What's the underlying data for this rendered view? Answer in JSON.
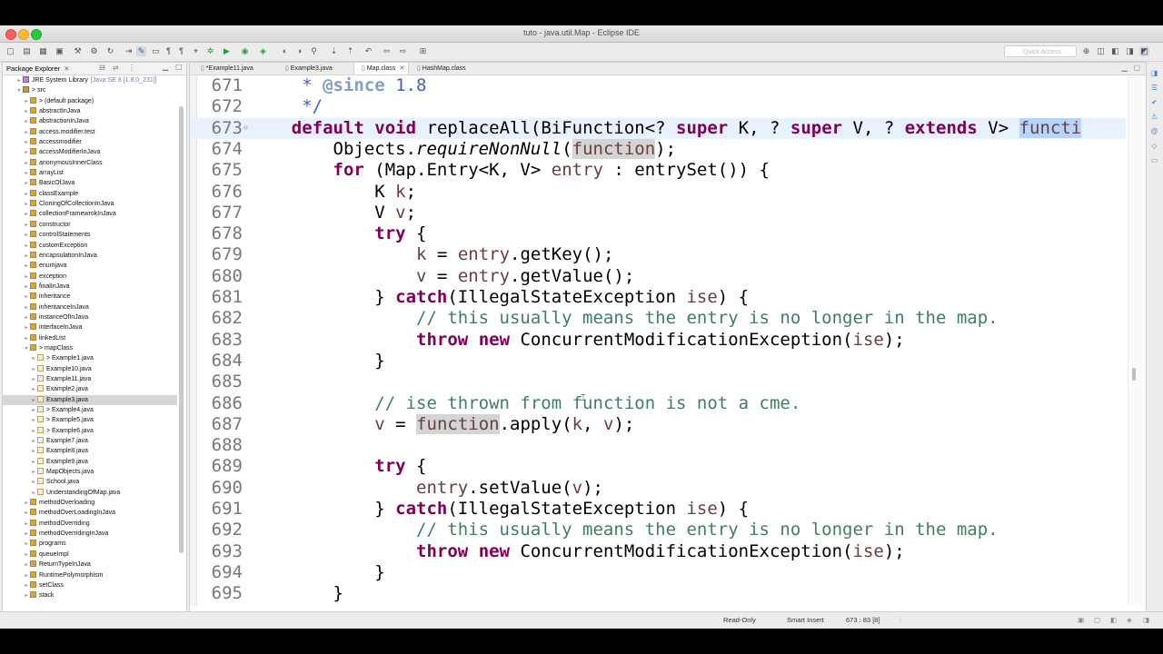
{
  "window": {
    "title": "tuto - java.util.Map - Eclipse IDE"
  },
  "toolbar": {
    "quick_access": "Quick Access"
  },
  "package_explorer": {
    "tab_label": "Package Explorer",
    "items": [
      {
        "label": "JRE System Library",
        "suffix": "[Java SE 8 [1.8.0_231]]",
        "icon": "library-icon",
        "indent": 2,
        "arrow": "▸"
      },
      {
        "label": "> src",
        "icon": "source-folder-icon",
        "indent": 2,
        "arrow": "▾"
      },
      {
        "label": "> (default package)",
        "icon": "package-icon",
        "indent": 3,
        "arrow": "▸"
      },
      {
        "label": "abstractInJava",
        "icon": "package-icon",
        "indent": 3,
        "arrow": "▸"
      },
      {
        "label": "abstractionInJava",
        "icon": "package-icon",
        "indent": 3,
        "arrow": "▸"
      },
      {
        "label": "access.modifier.test",
        "icon": "package-icon",
        "indent": 3,
        "arrow": "▸"
      },
      {
        "label": "accessmodifier",
        "icon": "package-icon",
        "indent": 3,
        "arrow": "▸"
      },
      {
        "label": "accessModifierInJava",
        "icon": "package-icon",
        "indent": 3,
        "arrow": "▸"
      },
      {
        "label": "anonymousInnerClass",
        "icon": "package-icon",
        "indent": 3,
        "arrow": "▸"
      },
      {
        "label": "arrayList",
        "icon": "package-icon",
        "indent": 3,
        "arrow": "▸"
      },
      {
        "label": "BasicOfJava",
        "icon": "package-icon",
        "indent": 3,
        "arrow": "▸"
      },
      {
        "label": "classExample",
        "icon": "package-icon",
        "indent": 3,
        "arrow": "▸"
      },
      {
        "label": "CloningOfCollectionInJava",
        "icon": "package-icon",
        "indent": 3,
        "arrow": "▸"
      },
      {
        "label": "collectionFramewrokInJava",
        "icon": "package-icon",
        "indent": 3,
        "arrow": "▸"
      },
      {
        "label": "constructor",
        "icon": "package-icon",
        "indent": 3,
        "arrow": "▸"
      },
      {
        "label": "controlStatements",
        "icon": "package-icon",
        "indent": 3,
        "arrow": "▸"
      },
      {
        "label": "customException",
        "icon": "package-icon",
        "indent": 3,
        "arrow": "▸"
      },
      {
        "label": "encapsulationInJava",
        "icon": "package-icon",
        "indent": 3,
        "arrow": "▸"
      },
      {
        "label": "enumjava",
        "icon": "package-icon",
        "indent": 3,
        "arrow": "▸"
      },
      {
        "label": "exception",
        "icon": "package-icon",
        "indent": 3,
        "arrow": "▸"
      },
      {
        "label": "finalInJava",
        "icon": "package-icon",
        "indent": 3,
        "arrow": "▸"
      },
      {
        "label": "inheritance",
        "icon": "package-icon",
        "indent": 3,
        "arrow": "▸"
      },
      {
        "label": "inheritanceInJava",
        "icon": "package-icon",
        "indent": 3,
        "arrow": "▸"
      },
      {
        "label": "instanceOfInJava",
        "icon": "package-icon",
        "indent": 3,
        "arrow": "▸"
      },
      {
        "label": "interfaceInJava",
        "icon": "package-icon",
        "indent": 3,
        "arrow": "▸"
      },
      {
        "label": "linkedList",
        "icon": "package-icon",
        "indent": 3,
        "arrow": "▸"
      },
      {
        "label": "> mapClass",
        "icon": "package-icon",
        "indent": 3,
        "arrow": "▾"
      },
      {
        "label": "> Example1.java",
        "icon": "java-file-icon",
        "indent": 4,
        "arrow": "▸"
      },
      {
        "label": "Example10.java",
        "icon": "java-file-icon",
        "indent": 4,
        "arrow": "▸"
      },
      {
        "label": "Example11.java",
        "icon": "java-file-icon",
        "indent": 4,
        "arrow": "▸"
      },
      {
        "label": "Example2.java",
        "icon": "java-file-icon",
        "indent": 4,
        "arrow": "▸"
      },
      {
        "label": "Example3.java",
        "icon": "java-file-icon",
        "indent": 4,
        "arrow": "▸",
        "selected": true
      },
      {
        "label": "> Example4.java",
        "icon": "java-file-icon",
        "indent": 4,
        "arrow": "▸"
      },
      {
        "label": "> Example5.java",
        "icon": "java-file-icon",
        "indent": 4,
        "arrow": "▸"
      },
      {
        "label": "> Example6.java",
        "icon": "java-file-icon",
        "indent": 4,
        "arrow": "▸"
      },
      {
        "label": "Example7.java",
        "icon": "java-file-icon",
        "indent": 4,
        "arrow": "▸"
      },
      {
        "label": "Example8.java",
        "icon": "java-file-icon",
        "indent": 4,
        "arrow": "▸"
      },
      {
        "label": "Example9.java",
        "icon": "java-file-icon",
        "indent": 4,
        "arrow": "▸"
      },
      {
        "label": "MapObjects.java",
        "icon": "java-file-icon",
        "indent": 4,
        "arrow": "▸"
      },
      {
        "label": "School.java",
        "icon": "java-file-icon",
        "indent": 4,
        "arrow": "▸"
      },
      {
        "label": "UnderstandingOfMap.java",
        "icon": "java-file-icon",
        "indent": 4,
        "arrow": "▸"
      },
      {
        "label": "methodOverloading",
        "icon": "package-icon",
        "indent": 3,
        "arrow": "▸"
      },
      {
        "label": "methodOverLoadingInJava",
        "icon": "package-icon",
        "indent": 3,
        "arrow": "▸"
      },
      {
        "label": "methodOverriding",
        "icon": "package-icon",
        "indent": 3,
        "arrow": "▸"
      },
      {
        "label": "methodOverridingInJava",
        "icon": "package-icon",
        "indent": 3,
        "arrow": "▸"
      },
      {
        "label": "programs",
        "icon": "package-icon",
        "indent": 3,
        "arrow": "▸"
      },
      {
        "label": "queueImpl",
        "icon": "package-icon",
        "indent": 3,
        "arrow": "▸"
      },
      {
        "label": "ReturnTypeInJava",
        "icon": "package-icon",
        "indent": 3,
        "arrow": "▸"
      },
      {
        "label": "RuntimePolymorphism",
        "icon": "package-icon",
        "indent": 3,
        "arrow": "▸"
      },
      {
        "label": "setClass",
        "icon": "package-icon",
        "indent": 3,
        "arrow": "▸"
      },
      {
        "label": "stack",
        "icon": "package-icon",
        "indent": 3,
        "arrow": "▸"
      }
    ]
  },
  "editor": {
    "tabs": [
      {
        "label": "*Example11.java",
        "active": false
      },
      {
        "label": "Example3.java",
        "active": false
      },
      {
        "label": "Map.class",
        "active": true,
        "close": "✕"
      },
      {
        "label": "HashMap.class",
        "active": false
      }
    ],
    "lines": [
      {
        "num": "671",
        "html": "     <span class=\"jd\">* </span><span class=\"tag\">@since</span><span class=\"jd\"> 1.8</span>"
      },
      {
        "num": "672",
        "html": "     <span class=\"jd\">*/</span>"
      },
      {
        "num": "673",
        "current": true,
        "html": "    <span class=\"kw\">default</span> <span class=\"kw\">void</span> replaceAll(BiFunction&lt;? <span class=\"kw\">super</span> K, ? <span class=\"kw\">super</span> V, ? <span class=\"kw\">extends</span> V&gt; <span class=\"var occsel\">functi</span>"
      },
      {
        "num": "674",
        "html": "        Objects.<span class=\"it\">requireNonNull</span>(<span class=\"var occ\">function</span>);"
      },
      {
        "num": "675",
        "html": "        <span class=\"kw\">for</span> (Map.Entry&lt;K, V&gt; <span class=\"var\">entry</span> : entrySet()) {"
      },
      {
        "num": "676",
        "html": "            K <span class=\"var\">k</span>;"
      },
      {
        "num": "677",
        "html": "            V <span class=\"var\">v</span>;"
      },
      {
        "num": "678",
        "html": "            <span class=\"kw\">try</span> {"
      },
      {
        "num": "679",
        "html": "                <span class=\"var\">k</span> = <span class=\"var\">entry</span>.getKey();"
      },
      {
        "num": "680",
        "html": "                <span class=\"var\">v</span> = <span class=\"var\">entry</span>.getValue();"
      },
      {
        "num": "681",
        "html": "            } <span class=\"kw\">catch</span>(IllegalStateException <span class=\"var\">ise</span>) {"
      },
      {
        "num": "682",
        "html": "                <span class=\"cm\">// this usually means the entry is no longer in the map.</span>"
      },
      {
        "num": "683",
        "html": "                <span class=\"kw\">throw</span> <span class=\"kw\">new</span> ConcurrentModificationException(<span class=\"var\">ise</span>);"
      },
      {
        "num": "684",
        "html": "            }"
      },
      {
        "num": "685",
        "html": ""
      },
      {
        "num": "686",
        "html": "            <span class=\"cm\">// ise thrown from function is not a cme.</span>"
      },
      {
        "num": "687",
        "html": "            <span class=\"var\">v</span> = <span class=\"var occ\">function</span>.apply(<span class=\"var\">k</span>, <span class=\"var\">v</span>);"
      },
      {
        "num": "688",
        "html": ""
      },
      {
        "num": "689",
        "html": "            <span class=\"kw\">try</span> {"
      },
      {
        "num": "690",
        "html": "                <span class=\"var\">entry</span>.setValue(<span class=\"var\">v</span>);"
      },
      {
        "num": "691",
        "html": "            } <span class=\"kw\">catch</span>(IllegalStateException <span class=\"var\">ise</span>) {"
      },
      {
        "num": "692",
        "html": "                <span class=\"cm\">// this usually means the entry is no longer in the map.</span>"
      },
      {
        "num": "693",
        "html": "                <span class=\"kw\">throw</span> <span class=\"kw\">new</span> ConcurrentModificationException(<span class=\"var\">ise</span>);"
      },
      {
        "num": "694",
        "html": "            }"
      },
      {
        "num": "695",
        "html": "        }"
      }
    ]
  },
  "statusbar": {
    "mode": "Read-Only",
    "insert": "Smart Insert",
    "position": "673 : 83 [8]"
  },
  "colors": {
    "keyword": "#7f0055",
    "comment": "#3f7f5f",
    "javadoc": "#3f5fbf",
    "current_line": "#e8f2fe"
  }
}
